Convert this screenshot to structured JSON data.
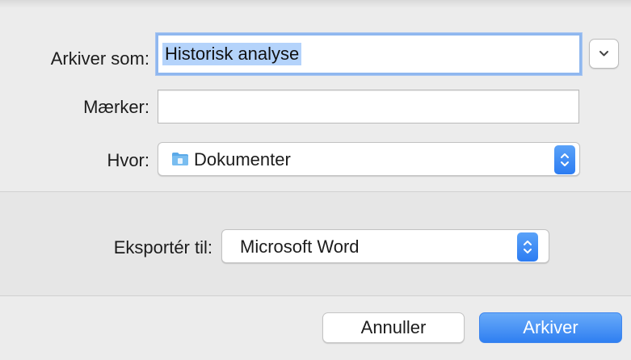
{
  "save": {
    "label": "Arkiver som:",
    "value": "Historisk analyse"
  },
  "tags": {
    "label": "Mærker:",
    "value": ""
  },
  "where": {
    "label": "Hvor:",
    "value": "Dokumenter",
    "icon": "folder-icon"
  },
  "export": {
    "label": "Eksportér til:",
    "value": "Microsoft Word"
  },
  "buttons": {
    "cancel": "Annuller",
    "primary": "Arkiver"
  },
  "colors": {
    "accent": "#2f7ff1",
    "selection": "#b4d3fb",
    "focus_ring": "#8fb7ef"
  }
}
